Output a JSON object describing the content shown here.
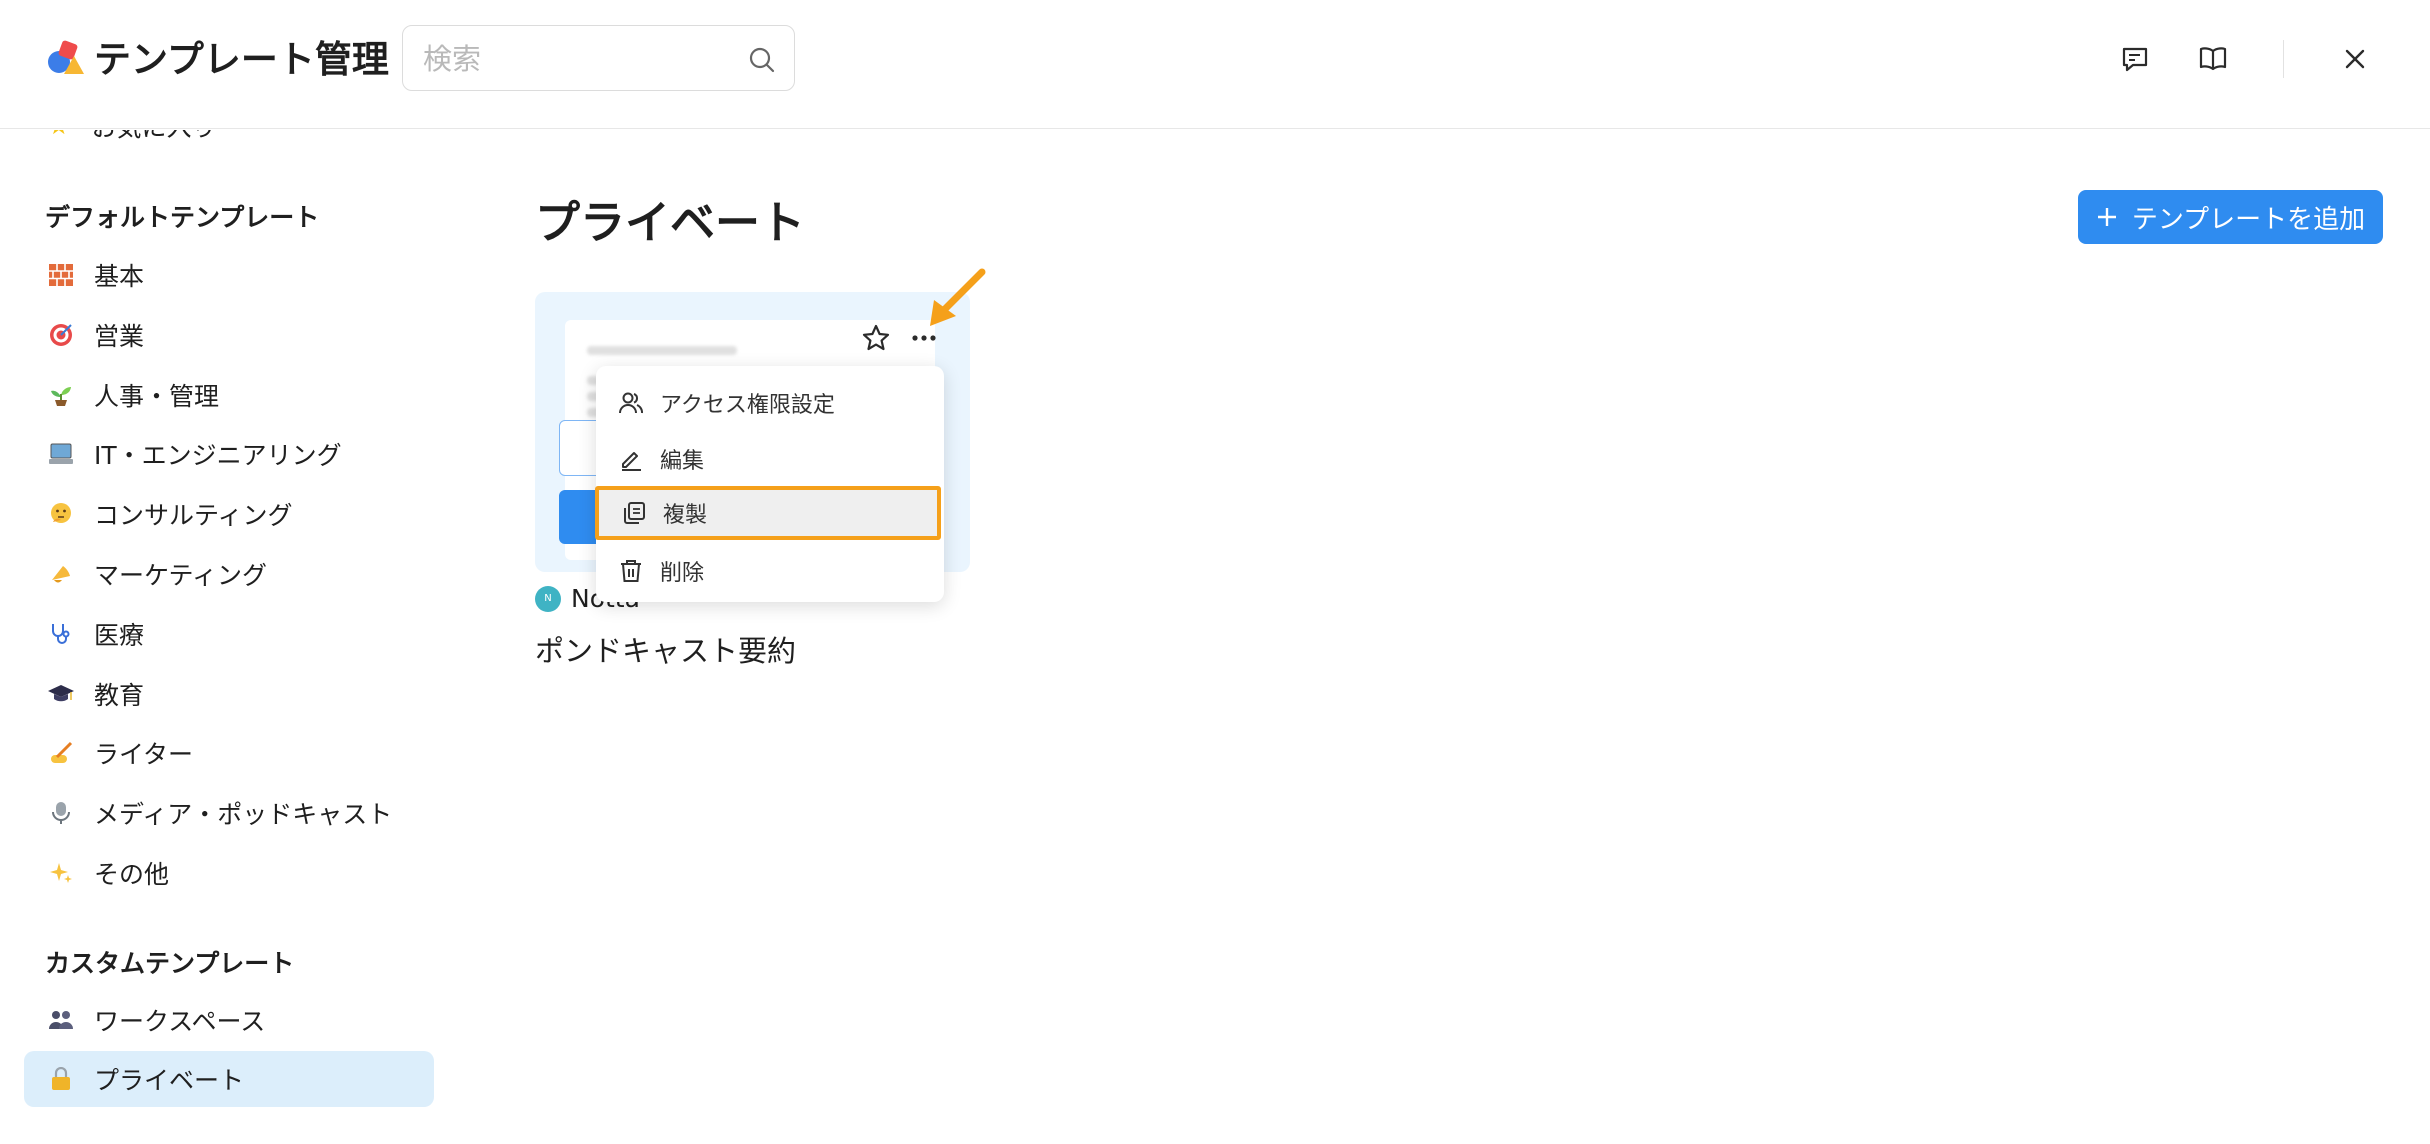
{
  "header": {
    "title": "テンプレート管理",
    "search_placeholder": "検索",
    "buttons": [
      "feedback-icon",
      "book-icon",
      "close-icon"
    ]
  },
  "sidebar": {
    "cut_item_label": "お気に入り",
    "default_section_title": "デフォルトテンプレート",
    "default_items": [
      {
        "label": "基本",
        "icon": "brick-icon"
      },
      {
        "label": "営業",
        "icon": "target-icon"
      },
      {
        "label": "人事・管理",
        "icon": "seedling-icon"
      },
      {
        "label": "IT・エンジニアリング",
        "icon": "computer-icon"
      },
      {
        "label": "コンサルティング",
        "icon": "thinking-face-icon"
      },
      {
        "label": "マーケティング",
        "icon": "megaphone-icon"
      },
      {
        "label": "医療",
        "icon": "stethoscope-icon"
      },
      {
        "label": "教育",
        "icon": "graduation-cap-icon"
      },
      {
        "label": "ライター",
        "icon": "writing-hand-icon"
      },
      {
        "label": "メディア・ポッドキャスト",
        "icon": "microphone-icon"
      },
      {
        "label": "その他",
        "icon": "sparkles-icon"
      }
    ],
    "custom_section_title": "カスタムテンプレート",
    "custom_items": [
      {
        "label": "ワークスペース",
        "icon": "people-icon"
      },
      {
        "label": "プライベート",
        "icon": "lock-icon",
        "active": true
      }
    ]
  },
  "main": {
    "heading": "プライベート",
    "add_button_label": "テンプレートを追加",
    "card": {
      "author": "Notta",
      "author_initial": "N",
      "name": "ポンドキャスト要約"
    },
    "context_menu": [
      {
        "label": "アクセス権限設定",
        "icon": "users-icon"
      },
      {
        "label": "編集",
        "icon": "pencil-icon"
      },
      {
        "label": "複製",
        "icon": "copy-icon",
        "highlighted": true
      },
      {
        "label": "削除",
        "icon": "trash-icon"
      }
    ]
  },
  "colors": {
    "accent": "#2f8cf0",
    "active_nav_bg": "#dceefb",
    "card_bg": "#eaf5fe",
    "highlight_annotation": "#f5a01a"
  }
}
